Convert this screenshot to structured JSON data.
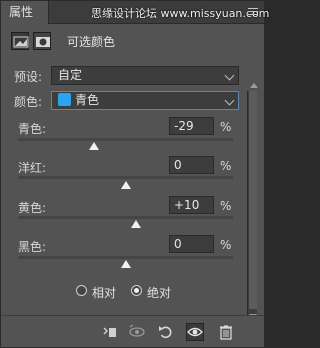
{
  "tab": {
    "label": "属性"
  },
  "watermark": "思缘设计论坛 www.missyuan.com",
  "header": {
    "title": "可选颜色"
  },
  "preset": {
    "label": "预设:",
    "value": "自定"
  },
  "colors": {
    "label": "颜色:",
    "value": "青色",
    "swatch": "#2aa3f0"
  },
  "sliders": [
    {
      "label": "青色:",
      "value": "-29",
      "unit": "%",
      "percent": -29
    },
    {
      "label": "洋红:",
      "value": "0",
      "unit": "%",
      "percent": 0
    },
    {
      "label": "黄色:",
      "value": "+10",
      "unit": "%",
      "percent": 10
    },
    {
      "label": "黑色:",
      "value": "0",
      "unit": "%",
      "percent": 0
    }
  ],
  "method": {
    "relative": "相对",
    "absolute": "绝对",
    "selected": "absolute"
  },
  "footer_icons": [
    "clip-to-layer-icon",
    "view-previous-icon",
    "reset-icon",
    "visibility-eye-icon",
    "trash-icon"
  ]
}
